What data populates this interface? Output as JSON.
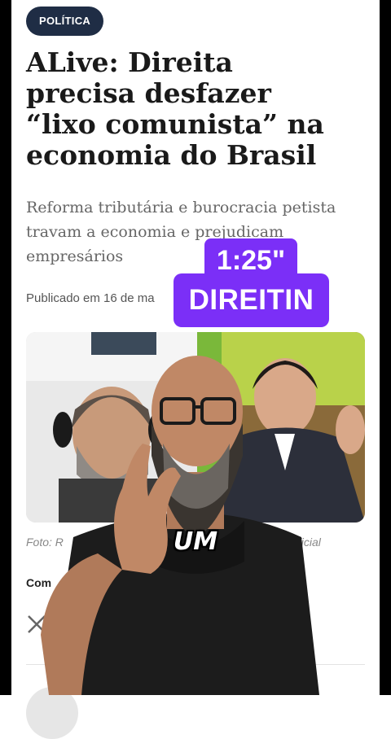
{
  "article": {
    "category": "POLÍTICA",
    "headline": "ALive: Direita\nprecisa desfazer\n“lixo comunista” na\neconomia do Brasil",
    "subtitle": "Reforma tributária e burocracia petista\ntravam a economia e prejudicam\nempresários",
    "published": "Publicado em 16 de ma",
    "photo_credit_prefix": "Foto: R",
    "photo_credit_suffix": "Oficial",
    "share_label": "Com",
    "share_x_icon": "x-logo-icon"
  },
  "overlay": {
    "timer": "1:25\"",
    "caption": "DIREITIN",
    "speech": "UM"
  },
  "colors": {
    "category_bg": "#1f2d45",
    "overlay_purple": "#7b2ff7",
    "headline_text": "#1a1a1a"
  }
}
